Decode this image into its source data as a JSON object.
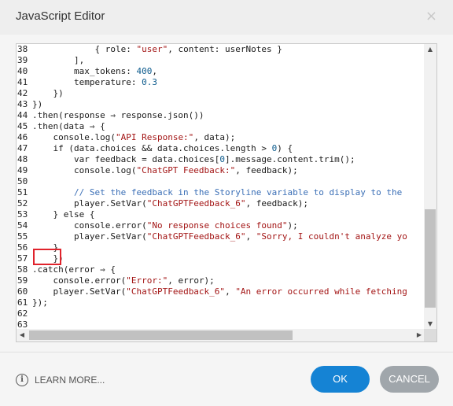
{
  "window": {
    "title": "JavaScript Editor",
    "close_glyph": "×"
  },
  "editor": {
    "lines": [
      {
        "n": "38",
        "segs": [
          {
            "t": "            { role: "
          },
          {
            "t": "\"user\"",
            "c": "str"
          },
          {
            "t": ", content: userNotes }"
          }
        ]
      },
      {
        "n": "39",
        "segs": [
          {
            "t": "        ],"
          }
        ]
      },
      {
        "n": "40",
        "segs": [
          {
            "t": "        max_tokens: "
          },
          {
            "t": "400",
            "c": "num"
          },
          {
            "t": ","
          }
        ]
      },
      {
        "n": "41",
        "segs": [
          {
            "t": "        temperature: "
          },
          {
            "t": "0.3",
            "c": "num"
          }
        ]
      },
      {
        "n": "42",
        "segs": [
          {
            "t": "    })"
          }
        ]
      },
      {
        "n": "43",
        "segs": [
          {
            "t": "})"
          }
        ]
      },
      {
        "n": "44",
        "segs": [
          {
            "t": ".then(response ⇒ response.json())"
          }
        ]
      },
      {
        "n": "45",
        "segs": [
          {
            "t": ".then(data ⇒ {"
          }
        ]
      },
      {
        "n": "46",
        "segs": [
          {
            "t": "    console.log("
          },
          {
            "t": "\"API Response:\"",
            "c": "str"
          },
          {
            "t": ", data);"
          }
        ]
      },
      {
        "n": "47",
        "segs": [
          {
            "t": "    if (data.choices && data.choices.length > "
          },
          {
            "t": "0",
            "c": "num"
          },
          {
            "t": ") {"
          }
        ]
      },
      {
        "n": "48",
        "segs": [
          {
            "t": "        var feedback = data.choices["
          },
          {
            "t": "0",
            "c": "num"
          },
          {
            "t": "].message.content.trim();"
          }
        ]
      },
      {
        "n": "49",
        "segs": [
          {
            "t": "        console.log("
          },
          {
            "t": "\"ChatGPT Feedback:\"",
            "c": "str"
          },
          {
            "t": ", feedback);"
          }
        ]
      },
      {
        "n": "50",
        "segs": [
          {
            "t": ""
          }
        ]
      },
      {
        "n": "51",
        "segs": [
          {
            "t": "        "
          },
          {
            "t": "// Set the feedback in the Storyline variable to display to the",
            "c": "cmt"
          }
        ]
      },
      {
        "n": "52",
        "segs": [
          {
            "t": "        player.SetVar("
          },
          {
            "t": "\"ChatGPTFeedback_6\"",
            "c": "str"
          },
          {
            "t": ", feedback);"
          }
        ]
      },
      {
        "n": "53",
        "segs": [
          {
            "t": "    } else {"
          }
        ]
      },
      {
        "n": "54",
        "segs": [
          {
            "t": "        console.error("
          },
          {
            "t": "\"No response choices found\"",
            "c": "str"
          },
          {
            "t": ");"
          }
        ]
      },
      {
        "n": "55",
        "segs": [
          {
            "t": "        player.SetVar("
          },
          {
            "t": "\"ChatGPTFeedback_6\"",
            "c": "str"
          },
          {
            "t": ", "
          },
          {
            "t": "\"Sorry, I couldn't analyze yo",
            "c": "str"
          }
        ]
      },
      {
        "n": "56",
        "segs": [
          {
            "t": "    }"
          }
        ]
      },
      {
        "n": "57",
        "segs": [
          {
            "t": "    })"
          }
        ]
      },
      {
        "n": "58",
        "segs": [
          {
            "t": ".catch(error ⇒ {"
          }
        ]
      },
      {
        "n": "59",
        "segs": [
          {
            "t": "    console.error("
          },
          {
            "t": "\"Error:\"",
            "c": "str"
          },
          {
            "t": ", error);"
          }
        ]
      },
      {
        "n": "60",
        "segs": [
          {
            "t": "    player.SetVar("
          },
          {
            "t": "\"ChatGPTFeedback_6\"",
            "c": "str"
          },
          {
            "t": ", "
          },
          {
            "t": "\"An error occurred while fetching",
            "c": "str"
          }
        ]
      },
      {
        "n": "61",
        "segs": [
          {
            "t": "});"
          }
        ]
      },
      {
        "n": "62",
        "segs": [
          {
            "t": ""
          }
        ]
      },
      {
        "n": "63",
        "segs": [
          {
            "t": ""
          }
        ]
      }
    ],
    "highlighted_line": "57",
    "highlight_color": "#e0232c"
  },
  "scrollbars": {
    "vertical": {
      "up_icon": "up-arrow-icon",
      "down_icon": "down-arrow-icon",
      "up_glyph": "▲",
      "down_glyph": "▼"
    },
    "horizontal": {
      "left_icon": "left-arrow-icon",
      "right_icon": "right-arrow-icon",
      "left_glyph": "◀",
      "right_glyph": "▶"
    }
  },
  "footer": {
    "learn_more": "LEARN MORE...",
    "info_icon": "i",
    "ok_label": "OK",
    "cancel_label": "CANCEL"
  },
  "colors": {
    "ok_button": "#1583d4",
    "cancel_button": "#a0a6ab",
    "string": "#a31515",
    "comment": "#3b6fb6",
    "number": "#0b5a8c"
  }
}
